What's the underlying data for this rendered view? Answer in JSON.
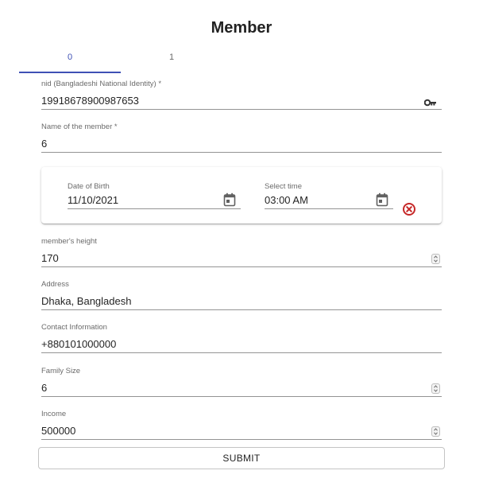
{
  "form": {
    "title": "Member"
  },
  "tabs": [
    {
      "label": "0",
      "active": true
    },
    {
      "label": "1",
      "active": false
    }
  ],
  "fields": {
    "nid": {
      "label": "nid (Bangladeshi National Identity) *",
      "value": "19918678900987653",
      "icon": "key-icon"
    },
    "name": {
      "label": "Name of the member *",
      "value": "6"
    },
    "dob": {
      "label": "Date of Birth",
      "value": "11/10/2021",
      "icon": "calendar-icon"
    },
    "time": {
      "label": "Select time",
      "value": "03:00 AM",
      "icon": "calendar-icon"
    },
    "height": {
      "label": "member's height",
      "value": "170"
    },
    "address": {
      "label": "Address",
      "value": "Dhaka, Bangladesh"
    },
    "contact": {
      "label": "Contact Information",
      "value": "+880101000000"
    },
    "family_size": {
      "label": "Family Size",
      "value": "6"
    },
    "income": {
      "label": "Income",
      "value": "500000"
    }
  },
  "clear_icon": "close-circle-icon",
  "submit_label": "SUBMIT",
  "colors": {
    "accent": "#3f51b5",
    "error": "#c62828",
    "icon": "#616161"
  }
}
